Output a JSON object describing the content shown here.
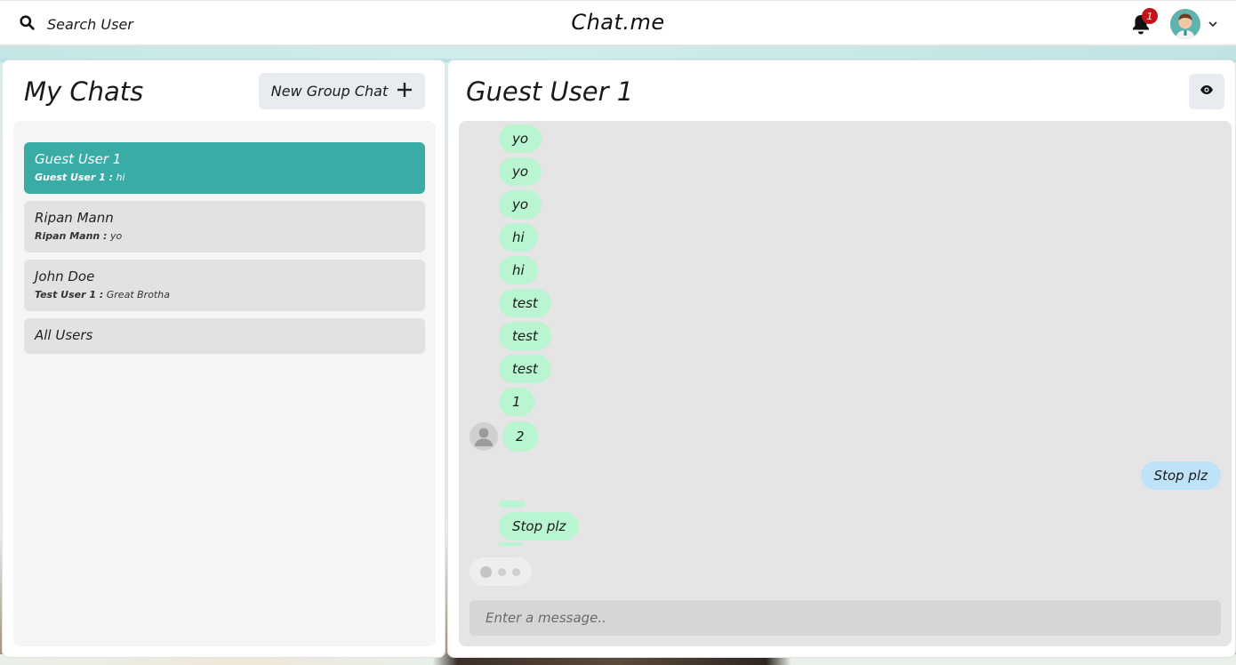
{
  "header": {
    "search_label": "Search User",
    "app_title": "Chat.me",
    "notification_count": "1"
  },
  "left": {
    "title": "My Chats",
    "new_group_label": "New Group Chat",
    "chats": [
      {
        "name": "Guest User 1",
        "sender": "Guest User 1 :",
        "preview": "hi",
        "active": true
      },
      {
        "name": "Ripan Mann",
        "sender": "Ripan Mann :",
        "preview": "yo",
        "active": false
      },
      {
        "name": "John Doe",
        "sender": "Test User 1 :",
        "preview": "Great Brotha",
        "active": false
      },
      {
        "name": "All Users",
        "sender": "",
        "preview": "",
        "active": false
      }
    ]
  },
  "chat": {
    "title": "Guest User 1",
    "messages": [
      {
        "text": "yo",
        "mine": false
      },
      {
        "text": "yo",
        "mine": false
      },
      {
        "text": "yo",
        "mine": false
      },
      {
        "text": "hi",
        "mine": false
      },
      {
        "text": "hi",
        "mine": false
      },
      {
        "text": "test",
        "mine": false
      },
      {
        "text": "test",
        "mine": false
      },
      {
        "text": "test",
        "mine": false
      },
      {
        "text": "1",
        "mine": false
      },
      {
        "text": "2",
        "mine": false
      },
      {
        "text": "Stop plz",
        "mine": true
      },
      {
        "text": "Stop plz",
        "mine": false
      }
    ],
    "input_placeholder": "Enter a message.."
  },
  "colors": {
    "accent": "#38aca5",
    "incoming_bubble": "#b9f5d0",
    "outgoing_bubble": "#bee3f8",
    "badge": "#c3121a"
  }
}
